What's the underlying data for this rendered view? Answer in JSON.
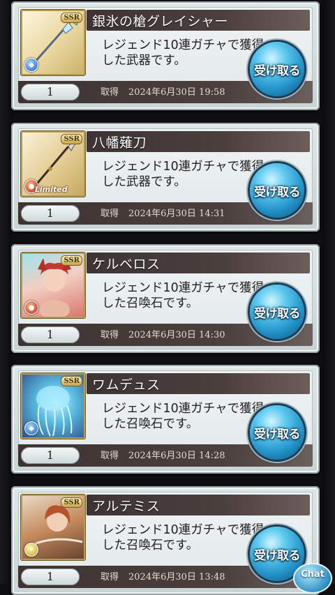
{
  "items": [
    {
      "name": "銀氷の槍グレイシャー",
      "desc": "レジェンド10連ガチャで獲得した武器です。",
      "qty": "1",
      "acq_label": "取得",
      "date": "2024年6月30日 19:58",
      "button": "受け取る",
      "rarity": "SSR",
      "element": "water",
      "element_icon": "water-element-icon",
      "limited": "",
      "thumb_icon": "spear-weapon-icon"
    },
    {
      "name": "八幡薙刀",
      "desc": "レジェンド10連ガチャで獲得した武器です。",
      "qty": "1",
      "acq_label": "取得",
      "date": "2024年6月30日 14:31",
      "button": "受け取る",
      "rarity": "SSR",
      "element": "fire",
      "element_icon": "fire-element-icon",
      "limited": "Limited",
      "thumb_icon": "naginata-weapon-icon"
    },
    {
      "name": "ケルベロス",
      "desc": "レジェンド10連ガチャで獲得した召喚石です。",
      "qty": "1",
      "acq_label": "取得",
      "date": "2024年6月30日 14:30",
      "button": "受け取る",
      "rarity": "SSR",
      "element": "fire",
      "element_icon": "fire-element-icon",
      "limited": "",
      "thumb_icon": "summon-portrait-icon"
    },
    {
      "name": "ワムデュス",
      "desc": "レジェンド10連ガチャで獲得した召喚石です。",
      "qty": "1",
      "acq_label": "取得",
      "date": "2024年6月30日 14:28",
      "button": "受け取る",
      "rarity": "SSR",
      "element": "water",
      "element_icon": "water-element-icon",
      "limited": "",
      "thumb_icon": "jellyfish-summon-icon"
    },
    {
      "name": "アルテミス",
      "desc": "レジェンド10連ガチャで獲得した召喚石です。",
      "qty": "1",
      "acq_label": "取得",
      "date": "2024年6月30日 13:48",
      "button": "受け取る",
      "rarity": "SSR",
      "element": "light",
      "element_icon": "light-element-icon",
      "limited": "",
      "thumb_icon": "summon-portrait-icon"
    }
  ],
  "chat_label": "Chat"
}
